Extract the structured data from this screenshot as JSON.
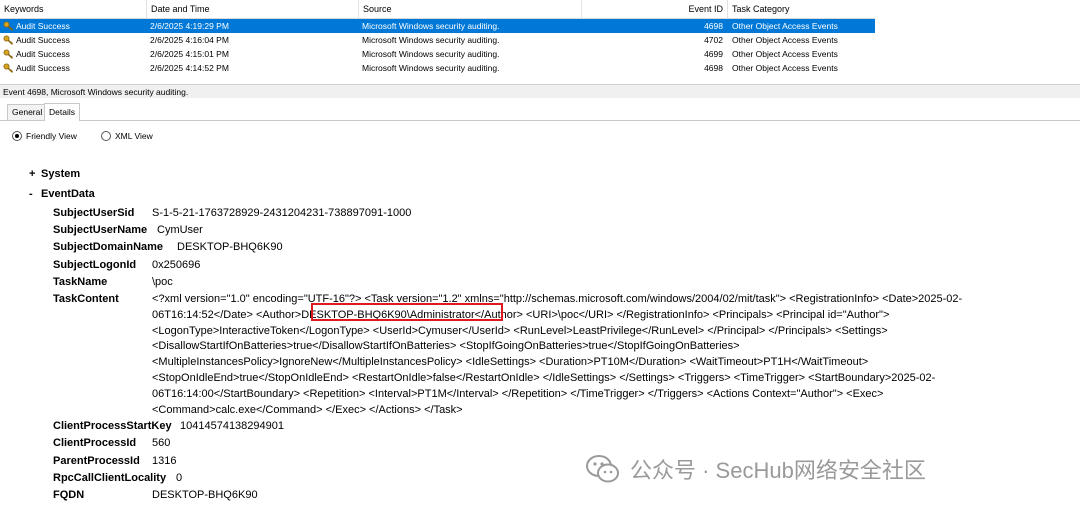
{
  "columns": {
    "keywords": "Keywords",
    "date_time": "Date and Time",
    "source": "Source",
    "event_id": "Event ID",
    "task_category": "Task Category"
  },
  "events": [
    {
      "keywords": "Audit Success",
      "date_time": "2/6/2025 4:19:29 PM",
      "source": "Microsoft Windows security auditing.",
      "event_id": "4698",
      "task_category": "Other Object Access Events",
      "selected": true
    },
    {
      "keywords": "Audit Success",
      "date_time": "2/6/2025 4:16:04 PM",
      "source": "Microsoft Windows security auditing.",
      "event_id": "4702",
      "task_category": "Other Object Access Events",
      "selected": false
    },
    {
      "keywords": "Audit Success",
      "date_time": "2/6/2025 4:15:01 PM",
      "source": "Microsoft Windows security auditing.",
      "event_id": "4699",
      "task_category": "Other Object Access Events",
      "selected": false
    },
    {
      "keywords": "Audit Success",
      "date_time": "2/6/2025 4:14:52 PM",
      "source": "Microsoft Windows security auditing.",
      "event_id": "4698",
      "task_category": "Other Object Access Events",
      "selected": false
    }
  ],
  "status": "Event 4698, Microsoft Windows security auditing.",
  "tabs": {
    "general": "General",
    "details": "Details"
  },
  "view_options": {
    "friendly": "Friendly View",
    "xml": "XML View",
    "selected": "friendly"
  },
  "tree": {
    "system": {
      "toggle": "+",
      "label": "System"
    },
    "eventdata": {
      "toggle": "-",
      "label": "EventData"
    }
  },
  "fields": {
    "subject_user_sid": {
      "name": "SubjectUserSid",
      "value": "S-1-5-21-1763728929-2431204231-738897091-1000"
    },
    "subject_user_name": {
      "name": "SubjectUserName",
      "value": "CymUser"
    },
    "subject_domain_name": {
      "name": "SubjectDomainName",
      "value": "DESKTOP-BHQ6K90"
    },
    "subject_logon_id": {
      "name": "SubjectLogonId",
      "value": "0x250696"
    },
    "task_name": {
      "name": "TaskName",
      "value": "\\poc"
    },
    "task_content": {
      "name": "TaskContent"
    },
    "client_process_start_key": {
      "name": "ClientProcessStartKey",
      "value": "10414574138294901"
    },
    "client_process_id": {
      "name": "ClientProcessId",
      "value": "560"
    },
    "parent_process_id": {
      "name": "ParentProcessId",
      "value": "1316"
    },
    "rpc_call_client_locality": {
      "name": "RpcCallClientLocality",
      "value": "0"
    },
    "fqdn": {
      "name": "FQDN",
      "value": "DESKTOP-BHQ6K90"
    }
  },
  "task_content_lines": [
    "<?xml version=\"1.0\" encoding=\"UTF-16\"?> <Task version=\"1.2\" xmlns=\"http://schemas.microsoft.com/windows/2004/02/mit/task\"> <RegistrationInfo> <Date>2025-02-",
    "06T16:14:52</Date> <Author>DESKTOP-BHQ6K90\\Administrator</Author> <URI>\\poc</URI> </RegistrationInfo> <Principals> <Principal id=\"Author\">",
    "<LogonType>InteractiveToken</LogonType> <UserId>Cymuser</UserId> <RunLevel>LeastPrivilege</RunLevel> </Principal> </Principals> <Settings>",
    "<DisallowStartIfOnBatteries>true</DisallowStartIfOnBatteries> <StopIfGoingOnBatteries>true</StopIfGoingOnBatteries>",
    "<MultipleInstancesPolicy>IgnoreNew</MultipleInstancesPolicy> <IdleSettings> <Duration>PT10M</Duration> <WaitTimeout>PT1H</WaitTimeout>",
    "<StopOnIdleEnd>true</StopOnIdleEnd> <RestartOnIdle>false</RestartOnIdle> </IdleSettings> </Settings> <Triggers> <TimeTrigger> <StartBoundary>2025-02-",
    "06T16:14:00</StartBoundary> <Repetition> <Interval>PT1M</Interval> </Repetition> </TimeTrigger> </Triggers> <Actions Context=\"Author\"> <Exec>",
    "<Command>calc.exe</Command> </Exec> </Actions> </Task>"
  ],
  "watermark": {
    "text": "公众号 · SecHub网络安全社区",
    "icon": "wechat-icon"
  },
  "colors": {
    "selection": "#0078d7",
    "highlight": "#e0191e",
    "watermark": "#9a9a9a"
  }
}
